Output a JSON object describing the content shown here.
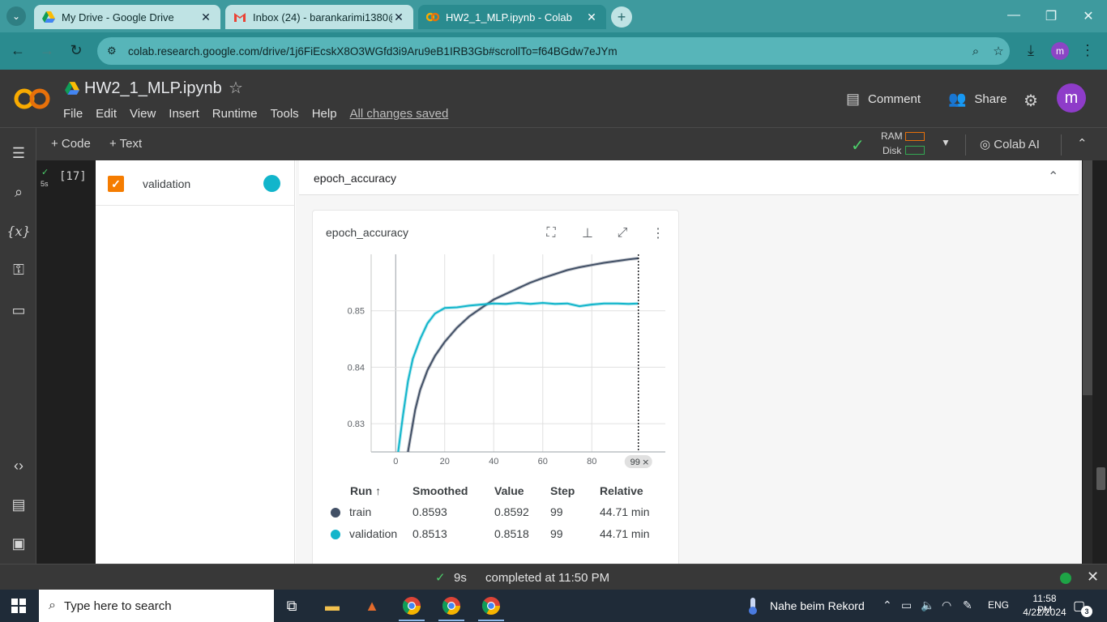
{
  "browser": {
    "tabs": [
      {
        "title": "My Drive - Google Drive",
        "icon": "google-drive-icon",
        "active": false
      },
      {
        "title": "Inbox (24) - barankarimi1380@",
        "icon": "gmail-icon",
        "active": false
      },
      {
        "title": "HW2_1_MLP.ipynb - Colab",
        "icon": "colab-icon",
        "active": true
      }
    ],
    "url": "colab.research.google.com/drive/1j6FiEcskX8O3WGfd3i9Aru9eB1IRB3Gb#scrollTo=f64BGdw7eJYm",
    "profile_initial": "m",
    "theme_color": "#2a8b8f"
  },
  "colab": {
    "logo_text": "CO",
    "notebook_title": "HW2_1_MLP.ipynb",
    "menu": [
      "File",
      "Edit",
      "View",
      "Insert",
      "Runtime",
      "Tools",
      "Help"
    ],
    "save_status": "All changes saved",
    "comment_label": "Comment",
    "share_label": "Share",
    "user_initial": "m",
    "toolbar": {
      "add_code": "+ Code",
      "add_text": "+ Text",
      "ram_label": "RAM",
      "disk_label": "Disk",
      "colab_ai_label": "Colab AI"
    },
    "cell": {
      "exec_count": "[17]",
      "run_time": "5s"
    }
  },
  "tensorboard": {
    "run": {
      "label": "validation",
      "checked": true,
      "color": "#12b5cb"
    },
    "group_title": "epoch_accuracy",
    "card_title": "epoch_accuracy",
    "step_marker": "99",
    "table": {
      "headers": [
        "Run ↑",
        "Smoothed",
        "Value",
        "Step",
        "Relative"
      ],
      "rows": [
        {
          "run": "train",
          "color": "#425066",
          "smoothed": "0.8593",
          "value": "0.8592",
          "step": "99",
          "relative": "44.71 min"
        },
        {
          "run": "validation",
          "color": "#12b5cb",
          "smoothed": "0.8513",
          "value": "0.8518",
          "step": "99",
          "relative": "44.71 min"
        }
      ]
    }
  },
  "chart_data": {
    "type": "line",
    "title": "epoch_accuracy",
    "xlabel": "",
    "ylabel": "",
    "xlim": [
      -10,
      110
    ],
    "ylim": [
      0.825,
      0.86
    ],
    "x_ticks": [
      0,
      20,
      40,
      60,
      80
    ],
    "y_ticks": [
      0.83,
      0.84,
      0.85
    ],
    "y_tick_labels": [
      "0.83",
      "0.84",
      "0.85"
    ],
    "grid": true,
    "series": [
      {
        "name": "train",
        "color": "#425066",
        "x": [
          5,
          8,
          10,
          13,
          16,
          20,
          25,
          30,
          35,
          40,
          45,
          50,
          55,
          60,
          65,
          70,
          75,
          80,
          85,
          90,
          95,
          99
        ],
        "y": [
          0.825,
          0.8325,
          0.836,
          0.8395,
          0.842,
          0.8445,
          0.847,
          0.849,
          0.8505,
          0.852,
          0.853,
          0.854,
          0.855,
          0.8558,
          0.8565,
          0.8572,
          0.8577,
          0.8581,
          0.8585,
          0.8588,
          0.8591,
          0.8593
        ]
      },
      {
        "name": "validation",
        "color": "#12b5cb",
        "x": [
          1,
          3,
          5,
          7,
          10,
          13,
          16,
          20,
          25,
          30,
          35,
          40,
          45,
          50,
          55,
          60,
          65,
          70,
          75,
          80,
          85,
          90,
          95,
          99
        ],
        "y": [
          0.825,
          0.8315,
          0.8375,
          0.8415,
          0.845,
          0.8478,
          0.8495,
          0.8505,
          0.8506,
          0.8509,
          0.8511,
          0.8513,
          0.8512,
          0.8514,
          0.8512,
          0.8514,
          0.8512,
          0.8513,
          0.8508,
          0.8511,
          0.8513,
          0.8513,
          0.8512,
          0.8513
        ]
      }
    ]
  },
  "statusbar": {
    "exec_time": "9s",
    "message": "completed at 11:50 PM"
  },
  "taskbar": {
    "search_placeholder": "Type here to search",
    "weather_text": "Nahe beim Rekord",
    "language": "ENG",
    "time": "11:58 PM",
    "date": "4/22/2024",
    "notification_count": "3"
  }
}
